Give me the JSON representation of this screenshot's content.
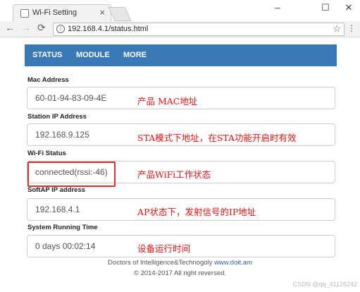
{
  "browser": {
    "tab_title": "Wi-Fi Setting",
    "url": "192.168.4.1/status.html"
  },
  "nav": {
    "items": [
      "STATUS",
      "MODULE",
      "MORE"
    ]
  },
  "fields": [
    {
      "label": "Mac Address",
      "value": "60-01-94-83-09-4E",
      "note": "产品 MAC地址"
    },
    {
      "label": "Station IP Address",
      "value": "192.168.9.125",
      "note": "STA模式下地址，在STA功能开启时有效"
    },
    {
      "label": "Wi-Fi Status",
      "value": "connected(rssi:-46)",
      "note": "产品WiFi工作状态"
    },
    {
      "label": "SoftAP IP address",
      "value": "192.168.4.1",
      "note": "AP状态下，发射信号的IP地址"
    },
    {
      "label": "System Running Time",
      "value": "0 days 00:02:14",
      "note": "设备运行时间"
    }
  ],
  "footer": {
    "line1": "Doctors of Intelligence&Technogoly",
    "link": "www.doit.am",
    "line2": "© 2014-2017 All right reversed."
  },
  "watermark": "CSDN @qq_41126242"
}
